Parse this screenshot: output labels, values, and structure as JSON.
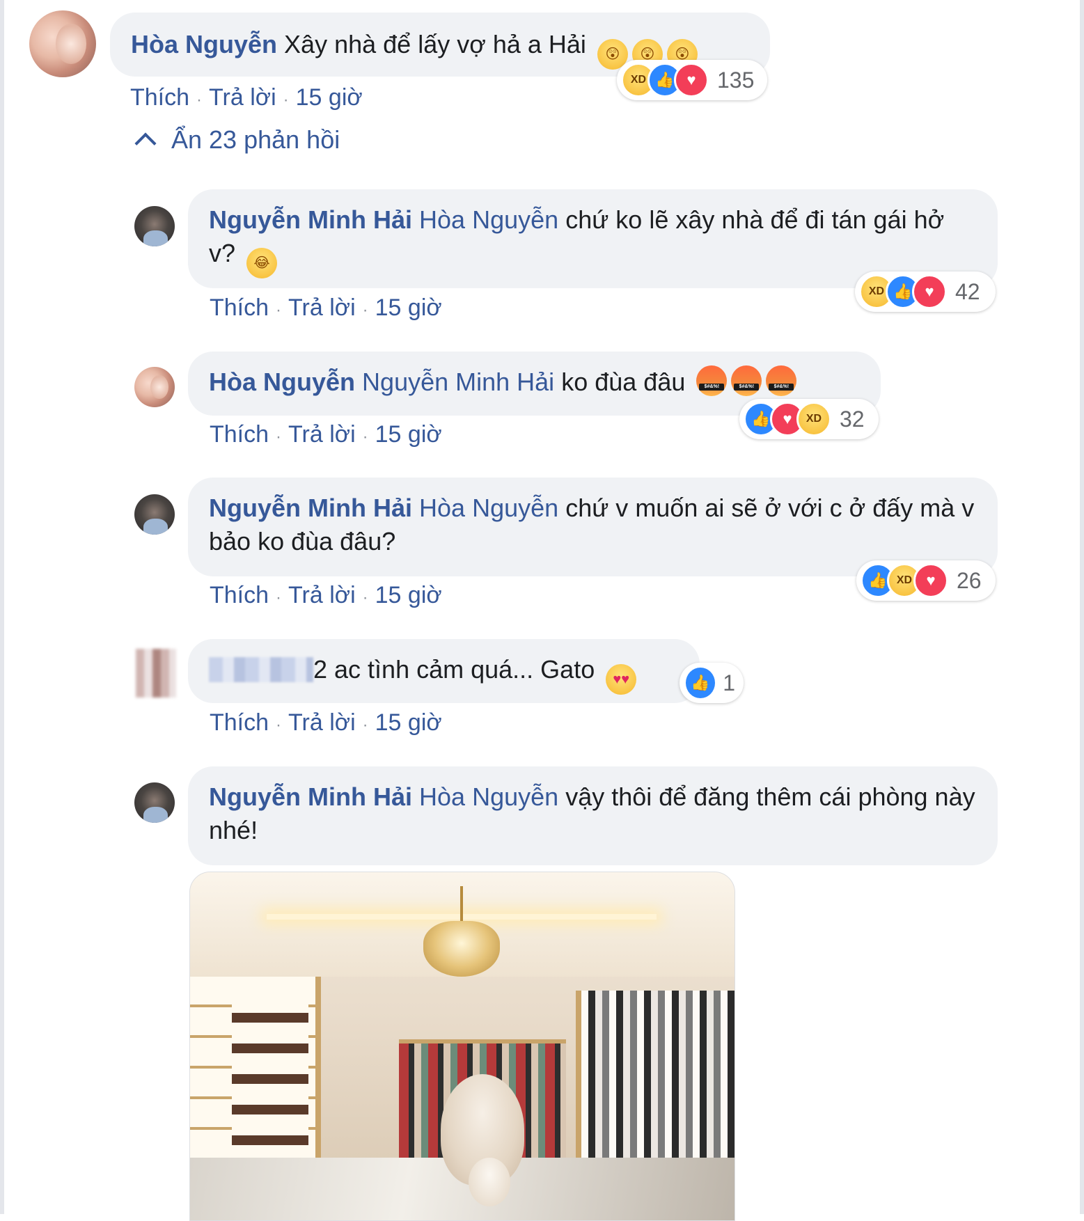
{
  "toggle_replies": {
    "label": "Ẩn 23 phản hồi"
  },
  "actions": {
    "like": "Thích",
    "reply": "Trả lời"
  },
  "comments": [
    {
      "author": "Hòa Nguyễn",
      "mention": "",
      "text": "Xây nhà để lấy vợ hả a Hải",
      "emojis": [
        "shocked-emoji",
        "shocked-emoji",
        "shocked-emoji"
      ],
      "time": "15 giờ",
      "reactions": [
        "haha",
        "like",
        "love"
      ],
      "reaction_count": "135"
    },
    {
      "author": "Nguyễn Minh Hải",
      "mention": "Hòa Nguyễn",
      "text": "chứ ko lẽ xây nhà để đi tán gái hở v?",
      "emojis": [
        "tears-of-joy-emoji"
      ],
      "time": "15 giờ",
      "reactions": [
        "haha",
        "like",
        "love"
      ],
      "reaction_count": "42"
    },
    {
      "author": "Hòa Nguyễn",
      "mention": "Nguyễn Minh Hải",
      "text": "ko đùa đâu",
      "emojis": [
        "cursing-emoji",
        "cursing-emoji",
        "cursing-emoji"
      ],
      "emoji_caption": "$#&%!",
      "time": "15 giờ",
      "reactions": [
        "like",
        "love",
        "haha"
      ],
      "reaction_count": "32"
    },
    {
      "author": "Nguyễn Minh Hải",
      "mention": "Hòa Nguyễn",
      "text": "chứ v muốn ai sẽ ở với c ở đấy mà v bảo ko đùa đâu?",
      "time": "15 giờ",
      "reactions": [
        "like",
        "haha",
        "love"
      ],
      "reaction_count": "26"
    },
    {
      "author": "",
      "mention": "",
      "text": "2 ac tình cảm quá... Gato",
      "emojis": [
        "heart-eyes-emoji"
      ],
      "time": "15 giờ",
      "reactions": [
        "like"
      ],
      "reaction_count": "1"
    },
    {
      "author": "Nguyễn Minh Hải",
      "mention": "Hòa Nguyễn",
      "text": "vậy thôi để đăng thêm cái phòng này nhé!",
      "time": "",
      "attachment": "walk-in-closet-photo"
    }
  ],
  "colors": {
    "link": "#365899",
    "bubble": "#f0f2f5",
    "like": "#2d88ff",
    "love": "#f33e58"
  }
}
